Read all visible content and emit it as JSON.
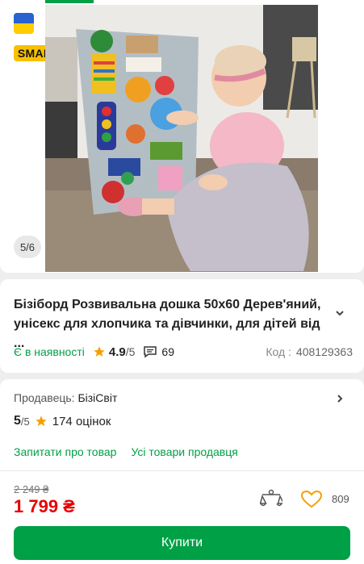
{
  "gallery": {
    "counter": "5/6",
    "badge_text": "SMART",
    "photo_subject": "baby playing with busy board"
  },
  "product": {
    "title": "Бізіборд Розвивальна дошка 50х60 Дерев'яний, унісекс для хлопчика та дівчинки, для дітей від ...",
    "availability": "Є в наявності",
    "rating": "4.9",
    "rating_max": "/5",
    "reviews_count": "69",
    "code_label": "Код :",
    "code_value": "408129363"
  },
  "seller": {
    "label": "Продавець:",
    "name": "БізіСвіт",
    "rating": "5",
    "rating_max": "/5",
    "ratings_count": "174 оцінок",
    "ask_link": "Запитати про товар",
    "all_products_link": "Усі товари продавця"
  },
  "pricing": {
    "old_price": "2 249 ₴",
    "price": "1 799 ₴",
    "likes_count": "809",
    "buy_label": "Купити"
  },
  "colors": {
    "accent_green": "#00a046",
    "price_red": "#e60000",
    "star_orange": "#f5a000"
  }
}
